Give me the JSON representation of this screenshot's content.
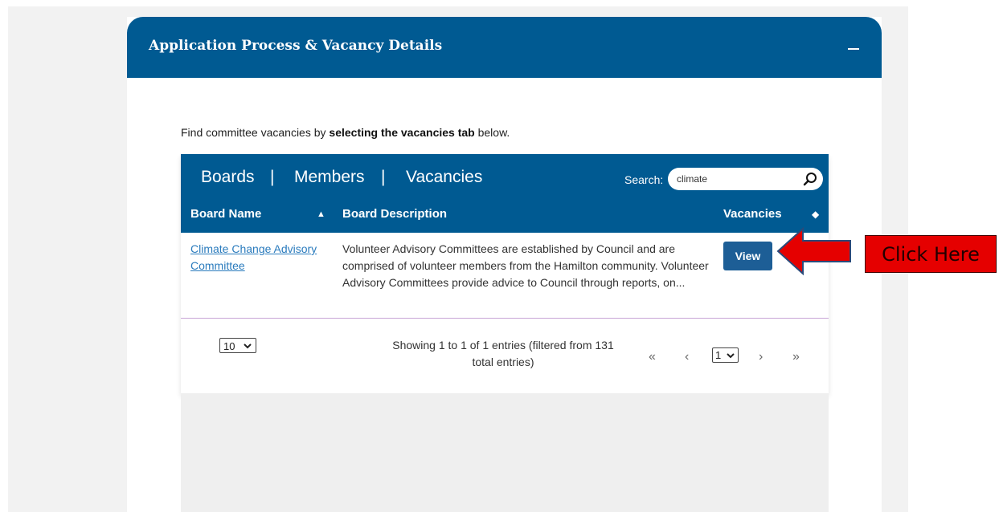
{
  "card": {
    "title": "Application Process & Vacancy Details",
    "collapse_icon": "minus-icon"
  },
  "intro": {
    "prefix": "Find committee vacancies by ",
    "bold": "selecting the vacancies tab",
    "suffix": " below."
  },
  "tabs": [
    {
      "label": "Boards"
    },
    {
      "label": "Members"
    },
    {
      "label": "Vacancies"
    }
  ],
  "tab_separator": "|",
  "search": {
    "label": "Search:",
    "value": "climate",
    "icon": "search-icon"
  },
  "columns": {
    "board_name": "Board Name",
    "board_description": "Board Description",
    "vacancies": "Vacancies",
    "sort_asc_icon": "▲",
    "sort_both_icon": "◆"
  },
  "rows": [
    {
      "board_name": "Climate Change Advisory Committee",
      "description": "Volunteer Advisory Committees are established by Council and are comprised of volunteer members from the Hamilton community. Volunteer Advisory Committees provide advice to Council through reports, on...",
      "action_label": "View"
    }
  ],
  "footer": {
    "page_length": "10",
    "info": "Showing 1 to 1 of 1 entries (filtered from 131 total entries)",
    "first": "«",
    "prev": "‹",
    "current_page": "1",
    "next": "›",
    "last": "»"
  },
  "annotation": {
    "label": "Click Here",
    "arrow_color": "#e50000",
    "icon": "left-arrow-icon"
  },
  "colors": {
    "brand_blue": "#005a92",
    "button_blue": "#1d5e96",
    "link_blue": "#2a7bbd",
    "annotation_red": "#e50000"
  }
}
